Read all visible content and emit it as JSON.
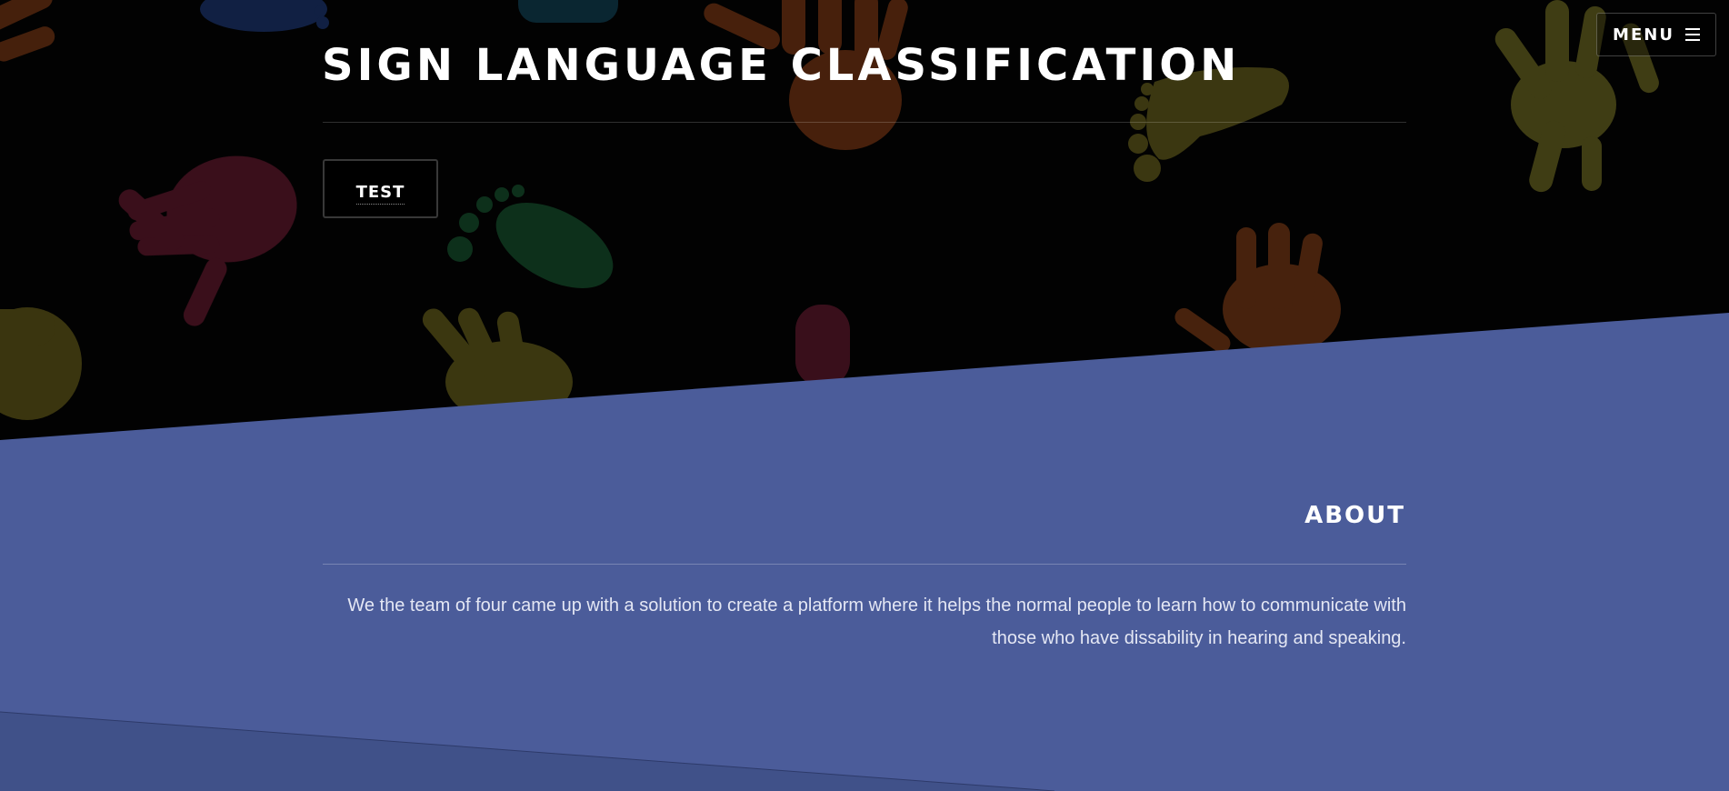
{
  "nav": {
    "menu_label": "MENU"
  },
  "hero": {
    "title": "SIGN LANGUAGE CLASSIFICATION",
    "test_button_label": "TEST"
  },
  "about": {
    "title": "ABOUT",
    "text": "We the team of four came up with a solution to create a platform where it helps the normal people to learn how to communicate with those who have dissability in hearing and speaking."
  },
  "colors": {
    "hero_background": "#020202",
    "about_background": "#4b5c9a",
    "bottom_band": "#405189",
    "text_light": "#ffffff"
  },
  "icons": {
    "menu": "hamburger-icon"
  }
}
